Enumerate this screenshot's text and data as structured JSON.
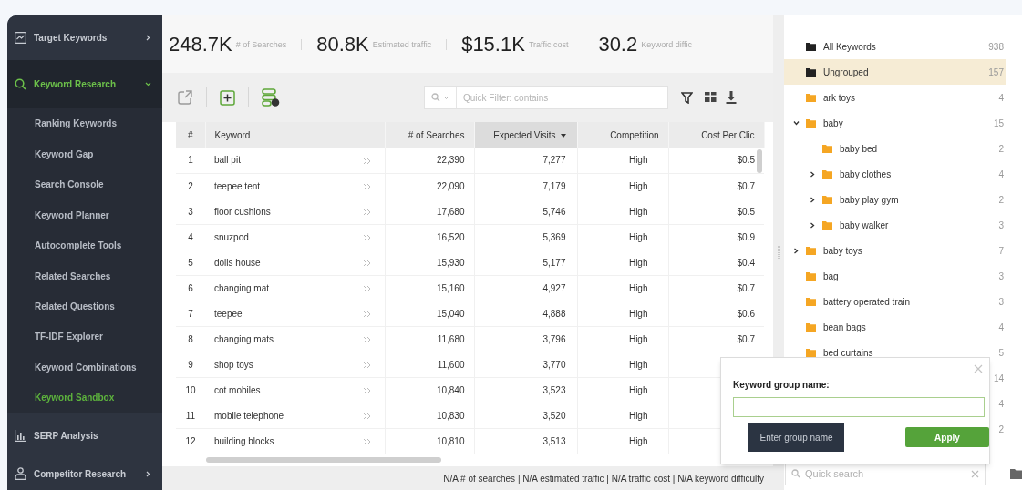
{
  "sidebar": {
    "items": [
      {
        "label": "Target Keywords",
        "expanded": false,
        "selected": false
      },
      {
        "label": "Keyword Research",
        "expanded": true,
        "selected": true,
        "children": [
          {
            "label": "Ranking Keywords",
            "selected": false
          },
          {
            "label": "Keyword Gap",
            "selected": false
          },
          {
            "label": "Search Console",
            "selected": false
          },
          {
            "label": "Keyword Planner",
            "selected": false
          },
          {
            "label": "Autocomplete Tools",
            "selected": false
          },
          {
            "label": "Related Searches",
            "selected": false
          },
          {
            "label": "Related Questions",
            "selected": false
          },
          {
            "label": "TF-IDF Explorer",
            "selected": false
          },
          {
            "label": "Keyword Combinations",
            "selected": false
          },
          {
            "label": "Keyword Sandbox",
            "selected": true
          }
        ]
      },
      {
        "label": "SERP Analysis",
        "selected": false
      },
      {
        "label": "Competitor Research",
        "expanded": false,
        "selected": false
      }
    ]
  },
  "stats": [
    {
      "value": "248.7K",
      "label": "# of Searches"
    },
    {
      "value": "80.8K",
      "label": "Estimated traffic"
    },
    {
      "value": "$15.1K",
      "label": "Traffic cost"
    },
    {
      "value": "30.2",
      "label": "Keyword diffic"
    }
  ],
  "toolbar": {
    "filter": {
      "placeholder": "Quick Filter: contains"
    }
  },
  "table": {
    "columns": [
      {
        "label": "#",
        "sorted": false
      },
      {
        "label": "Keyword",
        "sorted": false
      },
      {
        "label": "# of Searches",
        "sorted": false
      },
      {
        "label": "Expected Visits",
        "sorted": true
      },
      {
        "label": "Competition",
        "sorted": false
      },
      {
        "label": "Cost Per Clic",
        "sorted": false
      }
    ],
    "rows": [
      {
        "n": "1",
        "keyword": "ball pit",
        "searches": "22,390",
        "visits": "7,277",
        "competition": "High",
        "cpc": "$0.5"
      },
      {
        "n": "2",
        "keyword": "teepee tent",
        "searches": "22,090",
        "visits": "7,179",
        "competition": "High",
        "cpc": "$0.7"
      },
      {
        "n": "3",
        "keyword": "floor cushions",
        "searches": "17,680",
        "visits": "5,746",
        "competition": "High",
        "cpc": "$0.5"
      },
      {
        "n": "4",
        "keyword": "snuzpod",
        "searches": "16,520",
        "visits": "5,369",
        "competition": "High",
        "cpc": "$0.9"
      },
      {
        "n": "5",
        "keyword": "dolls house",
        "searches": "15,930",
        "visits": "5,177",
        "competition": "High",
        "cpc": "$0.4"
      },
      {
        "n": "6",
        "keyword": "changing mat",
        "searches": "15,160",
        "visits": "4,927",
        "competition": "High",
        "cpc": "$0.7"
      },
      {
        "n": "7",
        "keyword": "teepee",
        "searches": "15,040",
        "visits": "4,888",
        "competition": "High",
        "cpc": "$0.6"
      },
      {
        "n": "8",
        "keyword": "changing mats",
        "searches": "11,680",
        "visits": "3,796",
        "competition": "High",
        "cpc": "$0.7"
      },
      {
        "n": "9",
        "keyword": "shop toys",
        "searches": "11,600",
        "visits": "3,770",
        "competition": "High"
      },
      {
        "n": "10",
        "keyword": "cot mobiles",
        "searches": "10,840",
        "visits": "3,523",
        "competition": "High"
      },
      {
        "n": "11",
        "keyword": "mobile telephone",
        "searches": "10,830",
        "visits": "3,520",
        "competition": "High"
      },
      {
        "n": "12",
        "keyword": "building blocks",
        "searches": "10,810",
        "visits": "3,513",
        "competition": "High"
      }
    ]
  },
  "status_bar": "N/A # of searches | N/A estimated traffic | N/A traffic cost | N/A keyword difficulty",
  "groups": {
    "items": [
      {
        "label": "All Keywords",
        "count": "938",
        "kind": "root",
        "selected": false
      },
      {
        "label": "Ungrouped",
        "count": "157",
        "kind": "root",
        "selected": true
      },
      {
        "label": "ark toys",
        "count": "4",
        "kind": "group",
        "selected": false
      },
      {
        "label": "baby",
        "count": "15",
        "kind": "group",
        "selected": false,
        "expanded": true,
        "children": [
          {
            "label": "baby bed",
            "count": "2",
            "kind": "group",
            "selected": false
          },
          {
            "label": "baby clothes",
            "count": "4",
            "kind": "group",
            "selected": false,
            "expanded": false
          },
          {
            "label": "baby play gym",
            "count": "2",
            "kind": "group",
            "selected": false,
            "expanded": false
          },
          {
            "label": "baby walker",
            "count": "3",
            "kind": "group",
            "selected": false,
            "expanded": false
          }
        ]
      },
      {
        "label": "baby toys",
        "count": "7",
        "kind": "group",
        "selected": false,
        "expanded": false
      },
      {
        "label": "bag",
        "count": "3",
        "kind": "group",
        "selected": false
      },
      {
        "label": "battery operated train",
        "count": "3",
        "kind": "group",
        "selected": false
      },
      {
        "label": "bean bags",
        "count": "4",
        "kind": "group",
        "selected": false
      },
      {
        "label": "bed curtains",
        "count": "5",
        "kind": "group",
        "selected": false
      },
      {
        "count": "14",
        "selected": false
      },
      {
        "count": "4",
        "selected": false
      },
      {
        "count": "2",
        "selected": false
      }
    ],
    "search": {
      "placeholder": "Quick search"
    }
  },
  "dialog": {
    "label": "Keyword group name:",
    "tooltip": "Enter group name",
    "button": "Apply"
  }
}
